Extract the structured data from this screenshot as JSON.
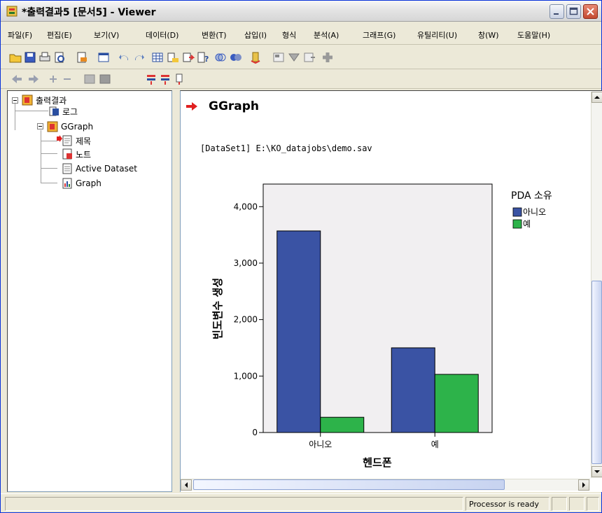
{
  "window": {
    "title": "*출력결과5 [문서5] - Viewer"
  },
  "menu": [
    "파일(F)",
    "편집(E)",
    "보기(V)",
    "데이터(D)",
    "변환(T)",
    "삽입(I)",
    "형식",
    "분석(A)",
    "그래프(G)",
    "유틸리티(U)",
    "창(W)",
    "도움말(H)"
  ],
  "outline": {
    "root": "출력결과",
    "log": "로그",
    "ggraph": "GGraph",
    "title": "제목",
    "notes": "노트",
    "active_dataset": "Active Dataset",
    "graph": "Graph"
  },
  "content": {
    "heading": "GGraph",
    "dataset_line": "[DataSet1] E:\\KO_datajobs\\demo.sav"
  },
  "chart_data": {
    "type": "bar",
    "categories": [
      "아니오",
      "예"
    ],
    "series": [
      {
        "name": "아니오",
        "color": "#3a53a4",
        "values": [
          3570,
          1500
        ]
      },
      {
        "name": "예",
        "color": "#2db34a",
        "values": [
          270,
          1030
        ]
      }
    ],
    "xlabel": "헨드폰",
    "ylabel": "빈도변수 생성",
    "legend_title": "PDA 소유",
    "legend_position": "top-right",
    "ylim": [
      0,
      4400
    ],
    "yticks": [
      0,
      1000,
      2000,
      3000,
      4000
    ],
    "ytick_labels": [
      "0",
      "1,000",
      "2,000",
      "3,000",
      "4,000"
    ],
    "grid": false,
    "plot_background": "#f1eff1"
  },
  "status": {
    "message": "Processor is ready"
  }
}
